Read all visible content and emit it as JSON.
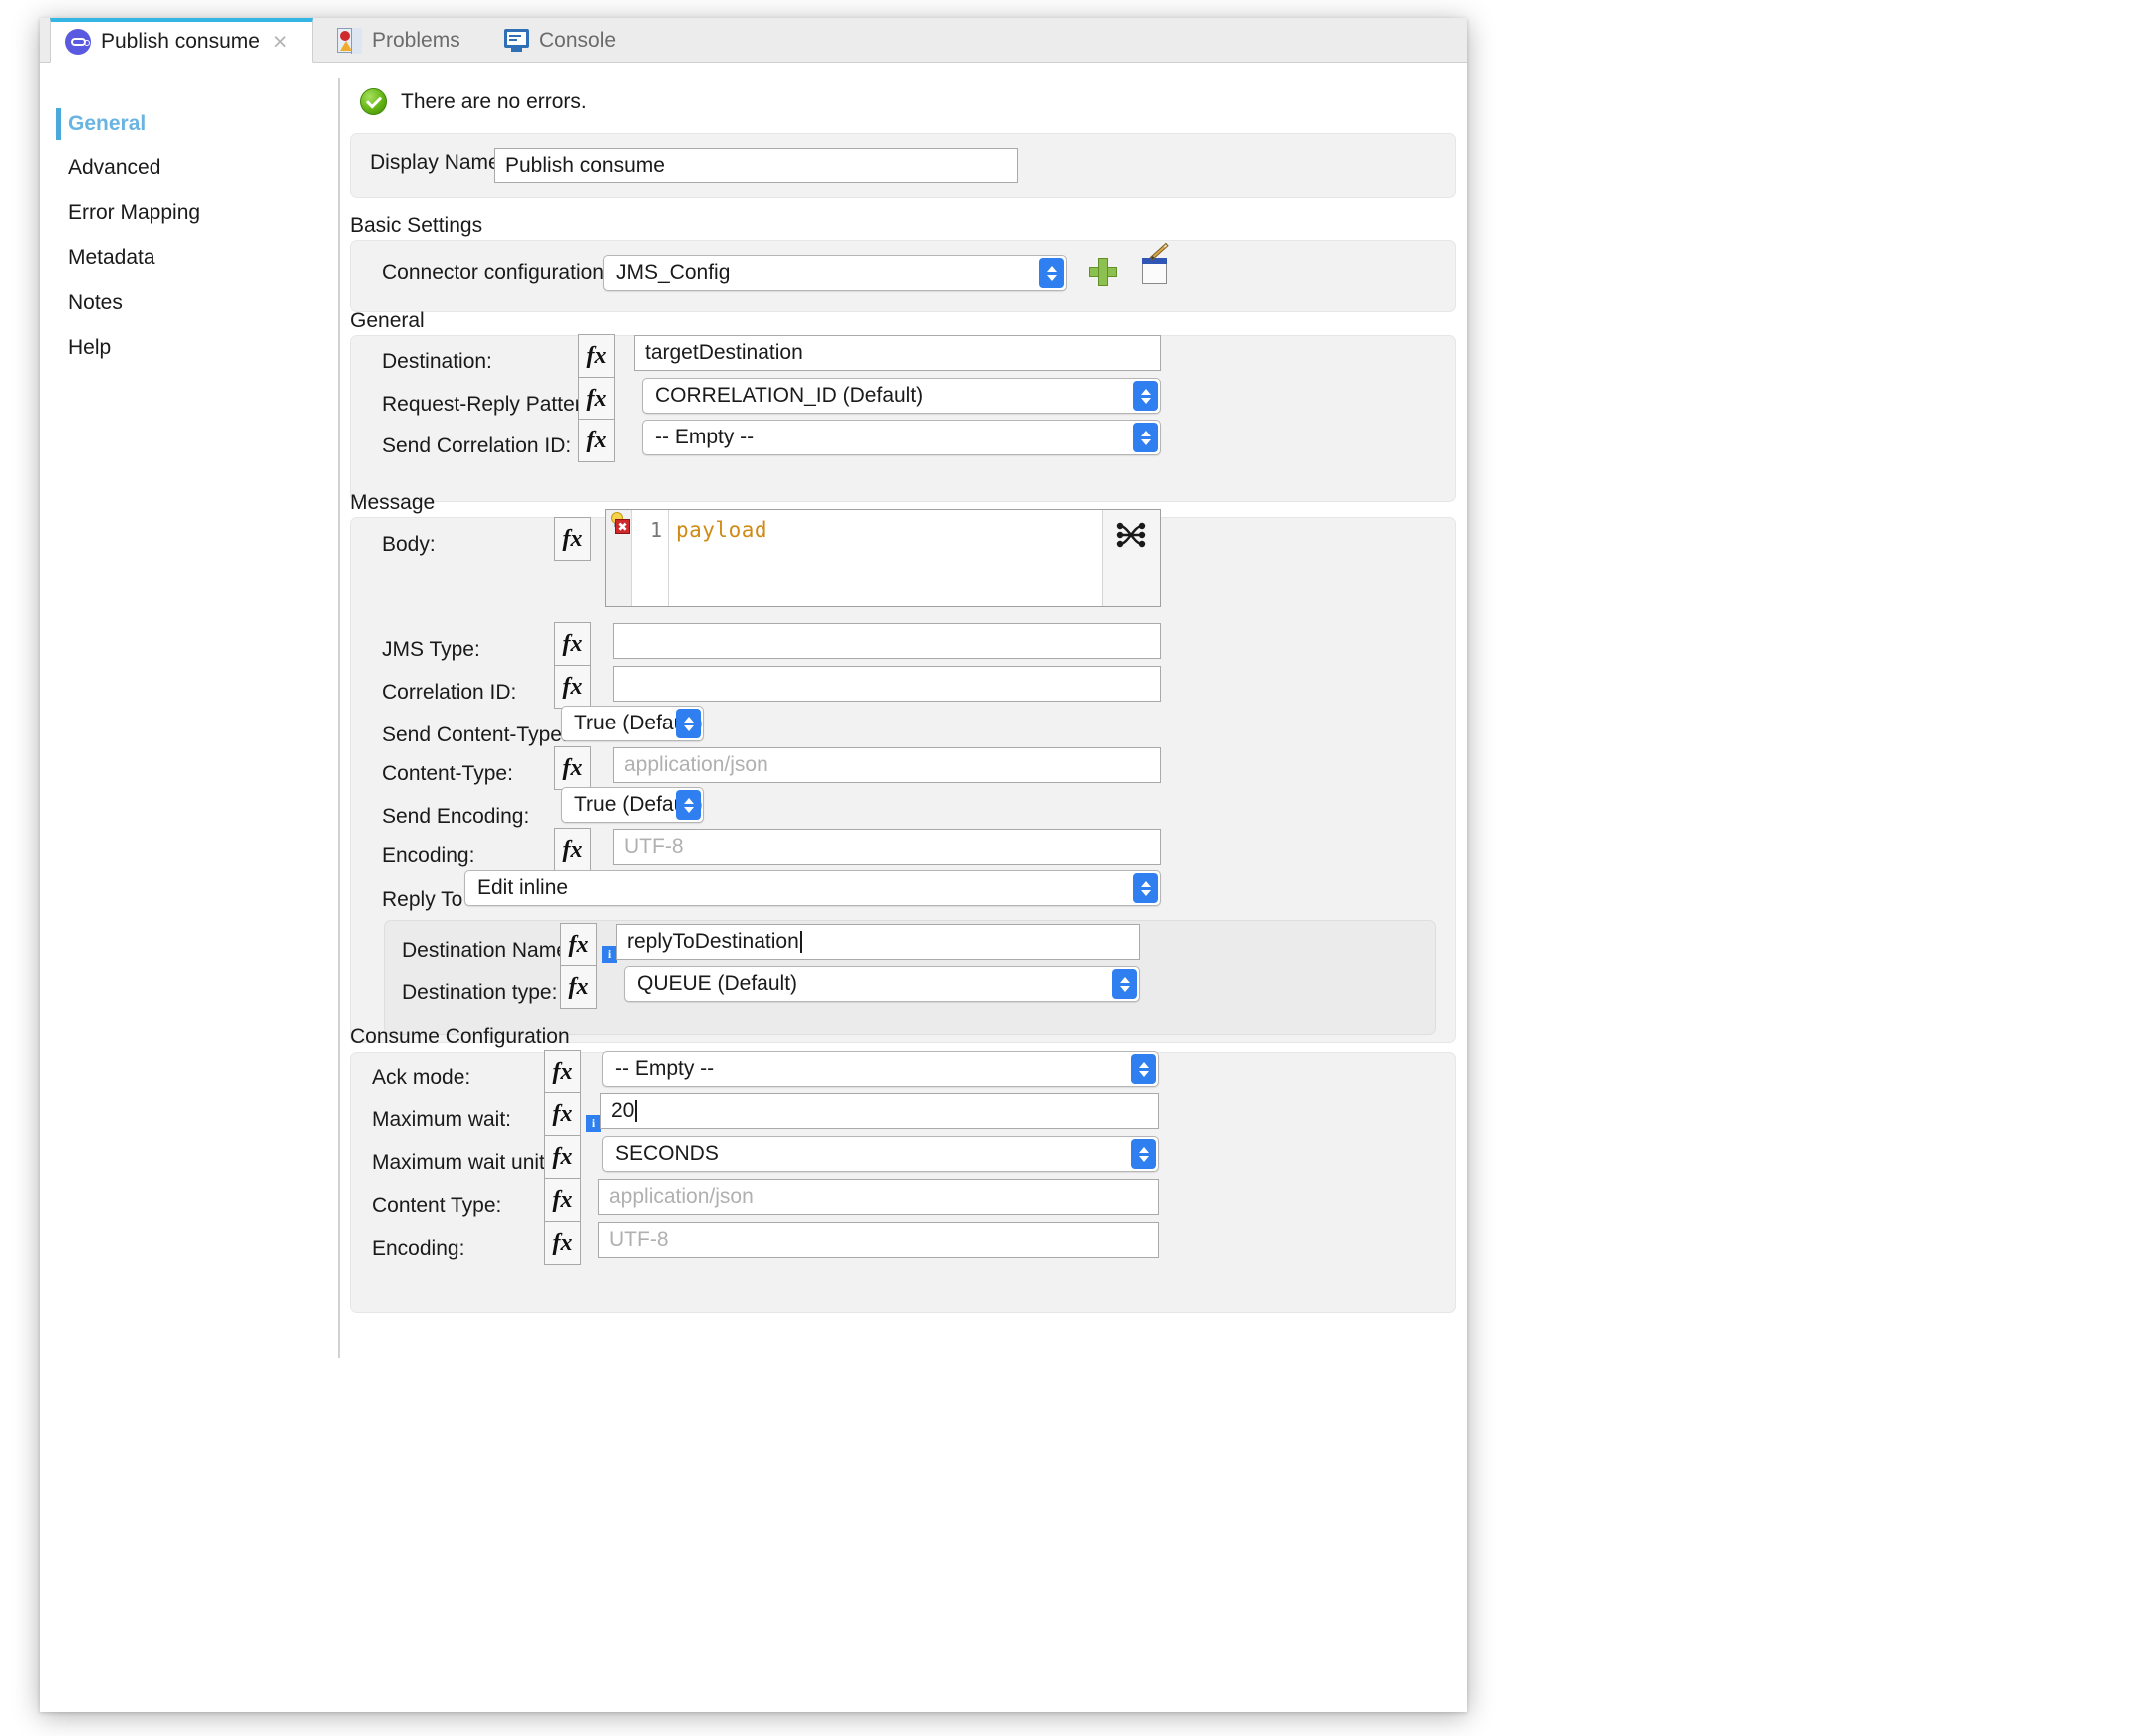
{
  "tabs": [
    {
      "label": "Publish consume",
      "icon": "mule-connector-icon",
      "active": true,
      "close": "×"
    },
    {
      "label": "Problems",
      "icon": "problems-icon",
      "active": false
    },
    {
      "label": "Console",
      "icon": "console-icon",
      "active": false
    }
  ],
  "sidebar": {
    "items": [
      {
        "label": "General",
        "active": true
      },
      {
        "label": "Advanced",
        "active": false
      },
      {
        "label": "Error Mapping",
        "active": false
      },
      {
        "label": "Metadata",
        "active": false
      },
      {
        "label": "Notes",
        "active": false
      },
      {
        "label": "Help",
        "active": false
      }
    ]
  },
  "status": {
    "icon": "success-check-icon",
    "text": "There are no errors."
  },
  "display_name": {
    "label": "Display Name:",
    "value": "Publish consume"
  },
  "basic_settings": {
    "title": "Basic Settings",
    "connector_config": {
      "label": "Connector configuration:",
      "value": "JMS_Config",
      "add_icon": "plus-icon",
      "edit_icon": "edit-icon"
    }
  },
  "general": {
    "title": "General",
    "destination": {
      "label": "Destination:",
      "value": "targetDestination",
      "fx": "fx"
    },
    "request_reply_pattern": {
      "label": "Request-Reply Pattern:",
      "value": "CORRELATION_ID (Default)",
      "fx": "fx"
    },
    "send_correlation_id": {
      "label": "Send Correlation ID:",
      "value": "-- Empty --",
      "fx": "fx"
    }
  },
  "message": {
    "title": "Message",
    "body": {
      "label": "Body:",
      "fx": "fx",
      "line_number": "1",
      "code": "payload",
      "bulb_icon": "lightbulb-icon",
      "error_icon": "error-marker-icon",
      "transform_icon": "transform-shuffle-icon"
    },
    "jms_type": {
      "label": "JMS Type:",
      "value": "",
      "fx": "fx"
    },
    "correlation_id": {
      "label": "Correlation ID:",
      "value": "",
      "fx": "fx"
    },
    "send_content_type": {
      "label": "Send Content-Type:",
      "value": "True (Default)"
    },
    "content_type": {
      "label": "Content-Type:",
      "placeholder": "application/json",
      "fx": "fx"
    },
    "send_encoding": {
      "label": "Send Encoding:",
      "value": "True (Default)"
    },
    "encoding": {
      "label": "Encoding:",
      "placeholder": "UTF-8",
      "fx": "fx"
    },
    "reply_to": {
      "label": "Reply To",
      "value": "Edit inline"
    },
    "destination_name": {
      "label": "Destination Name:",
      "value": "replyToDestination",
      "fx": "fx",
      "info_icon": "info-badge-icon"
    },
    "destination_type": {
      "label": "Destination type:",
      "value": "QUEUE (Default)",
      "fx": "fx"
    }
  },
  "consume_configuration": {
    "title": "Consume Configuration",
    "ack_mode": {
      "label": "Ack mode:",
      "value": "-- Empty --",
      "fx": "fx"
    },
    "maximum_wait": {
      "label": "Maximum wait:",
      "value": "20",
      "fx": "fx",
      "info_icon": "info-badge-icon"
    },
    "maximum_wait_unit": {
      "label": "Maximum wait unit:",
      "value": "SECONDS",
      "fx": "fx"
    },
    "content_type": {
      "label": "Content Type:",
      "placeholder": "application/json",
      "fx": "fx"
    },
    "encoding": {
      "label": "Encoding:",
      "placeholder": "UTF-8",
      "fx": "fx"
    }
  },
  "colors": {
    "accent": "#34b6e4",
    "sidebar_active": "#6ab4e2",
    "select_arrow": "#2f7ff0",
    "code_text": "#d08b16",
    "success": "#64b415"
  }
}
